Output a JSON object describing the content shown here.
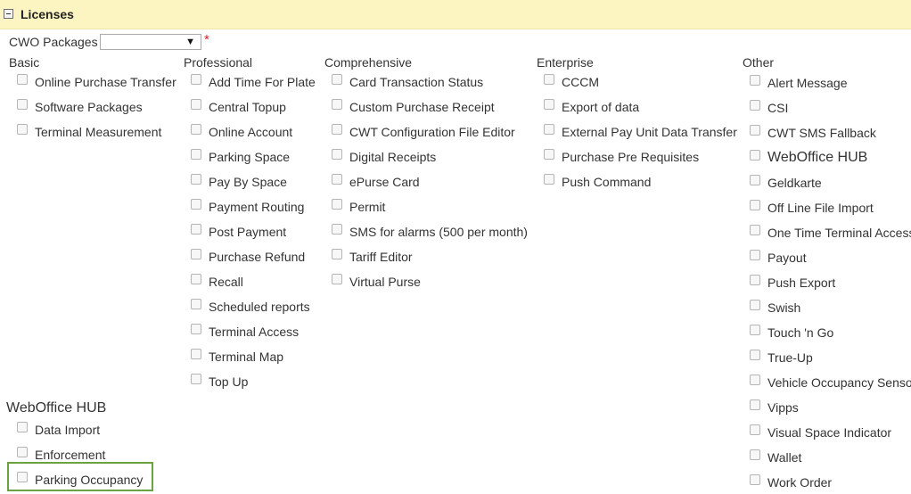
{
  "header": {
    "title": "Licenses"
  },
  "packages": {
    "label": "CWO Packages",
    "selected": "",
    "required_mark": "*"
  },
  "columns": {
    "basic": {
      "title": "Basic",
      "items": [
        "Online Purchase Transfer",
        "Software Packages",
        "Terminal Measurement"
      ]
    },
    "professional": {
      "title": "Professional",
      "items": [
        "Add Time For Plate",
        "Central Topup",
        "Online Account",
        "Parking Space",
        "Pay By Space",
        "Payment Routing",
        "Post Payment",
        "Purchase Refund",
        "Recall",
        "Scheduled reports",
        "Terminal Access",
        "Terminal Map",
        "Top Up"
      ]
    },
    "comprehensive": {
      "title": "Comprehensive",
      "items": [
        "Card Transaction Status",
        "Custom Purchase Receipt",
        "CWT Configuration File Editor",
        "Digital Receipts",
        "ePurse Card",
        "Permit",
        "SMS for alarms (500 per month)",
        "Tariff Editor",
        "Virtual Purse"
      ]
    },
    "enterprise": {
      "title": "Enterprise",
      "items": [
        "CCCM",
        "Export of data",
        "External Pay Unit Data Transfer",
        "Purchase Pre Requisites",
        "Push Command"
      ]
    },
    "other": {
      "title": "Other",
      "items": [
        "Alert Message",
        "CSI",
        "CWT SMS Fallback",
        "WebOffice HUB",
        "Geldkarte",
        "Off Line File Import",
        "One Time Terminal Access",
        "Payout",
        "Push Export",
        "Swish",
        "Touch 'n Go",
        "True-Up",
        "Vehicle Occupancy Sensor",
        "Vipps",
        "Visual Space Indicator",
        "Wallet",
        "Work Order"
      ]
    }
  },
  "hub": {
    "title": "WebOffice HUB",
    "items": [
      "Data Import",
      "Enforcement",
      "Parking Occupancy"
    ]
  },
  "colors": {
    "header_bg": "#fcf5c2",
    "highlight": "#6aa33f",
    "required": "#e0202a"
  }
}
